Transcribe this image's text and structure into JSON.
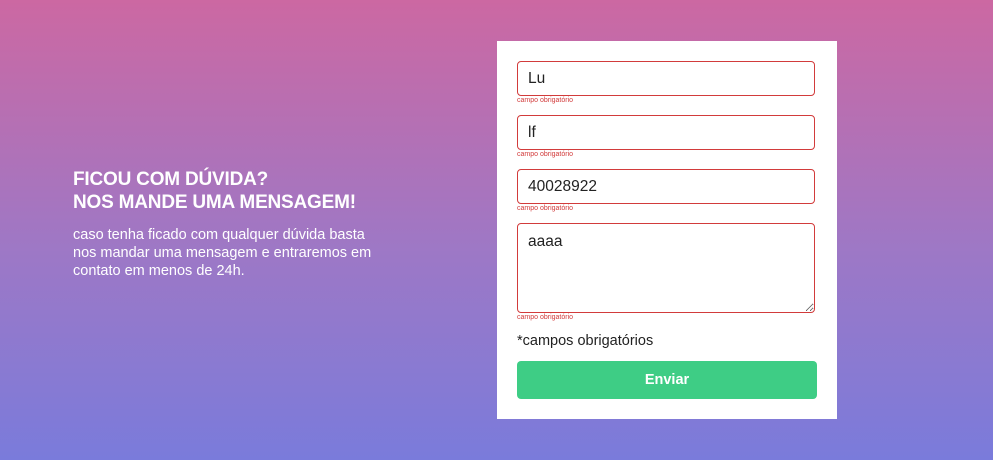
{
  "intro": {
    "heading_line1": "FICOU COM DÚVIDA?",
    "heading_line2": "NOS MANDE UMA MENSAGEM!",
    "description": "caso tenha ficado com qualquer dúvida basta nos mandar uma mensagem e entraremos em contato em menos de 24h."
  },
  "form": {
    "fields": [
      {
        "value": "Lu",
        "error": "campo obrigatório"
      },
      {
        "value": "lf",
        "error": "campo obrigatório"
      },
      {
        "value": "40028922",
        "error": "campo obrigatório"
      },
      {
        "value": "aaaa",
        "error": "campo obrigatório"
      }
    ],
    "required_note": "*campos obrigatórios",
    "submit_label": "Enviar"
  },
  "colors": {
    "error": "#d23b3b",
    "submit": "#3ecd85"
  }
}
